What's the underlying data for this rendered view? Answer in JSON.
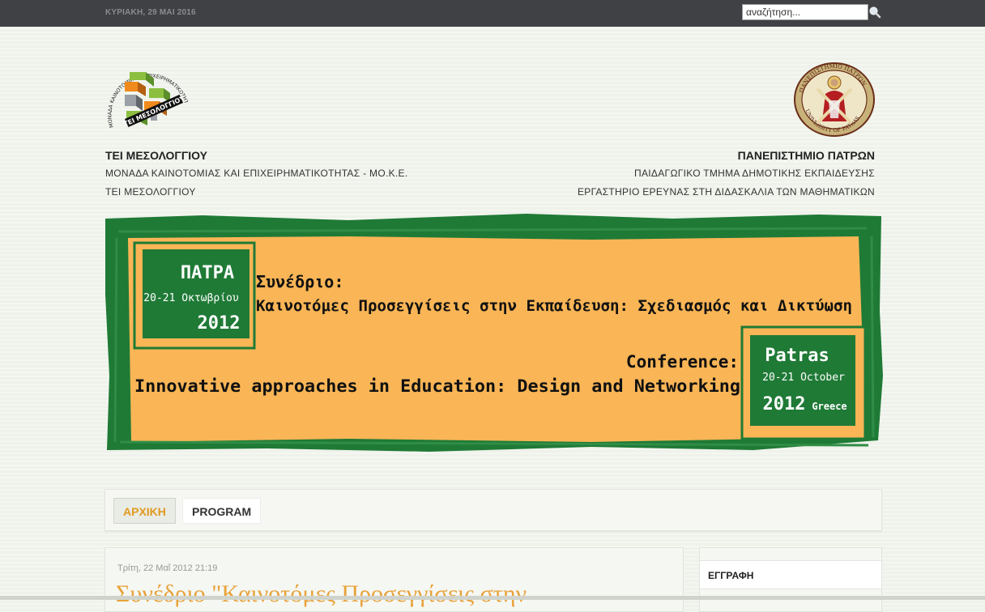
{
  "topbar": {
    "date": "ΚΥΡΙΑΚΗ, 29 ΜΑΙ 2016",
    "search_placeholder": "αναζήτηση...",
    "search_icon": "magnifier-icon"
  },
  "header": {
    "left": {
      "title": "ΤΕΙ ΜΕΣΟΛΟΓΓΙΟΥ",
      "line2": "ΜΟΝΑΔΑ ΚΑΙΝΟΤΟΜΙΑΣ ΚΑΙ ΕΠΙΧΕΙΡΗΜΑΤΙΚΟΤΗΤΑΣ - ΜΟ.Κ.Ε.",
      "line3": "ΤΕΙ ΜΕΣΟΛΟΓΓΙΟΥ",
      "logo_text_ring": "ΜΟΝΑΔΑ ΚΑΙΝΟΤΟΜΙΑΣ & ΕΠΙΧΕΙΡΗΜΑΤΙΚΟΤΗΤΑΣ",
      "logo_text_band": "ΤΕΙ ΜΕΣΟΛΟΓΓΙΟΥ"
    },
    "right": {
      "title": "ΠΑΝΕΠΙΣΤΗΜΙΟ ΠΑΤΡΩΝ",
      "line2": "ΠΑΙΔΑΓΩΓΙΚΟ ΤΜΗΜΑ ΔΗΜΟΤΙΚΗΣ ΕΚΠΑΙΔΕΥΣΗΣ",
      "line3": "ΕΡΓΑΣΤΗΡΙΟ ΕΡΕΥΝΑΣ ΣΤΗ ΔΙΔΑΣΚΑΛΙΑ ΤΩΝ ΜΑΘΗΜΑΤΙΚΩΝ",
      "seal_text_top": "ΠΑΝΕΠΙΣΤΗΜΙΟ ΠΑΤΡΩΝ",
      "seal_text_bottom": "UNIVERSITY OF PATRAS"
    }
  },
  "banner": {
    "gr_city": "ΠΑΤΡΑ",
    "gr_dates": "20-21 Οκτωβρίου",
    "gr_year": "2012",
    "gr_label": "Συνέδριο:",
    "gr_title": "Καινοτόμες Προσεγγίσεις στην Εκπαίδευση: Σχεδιασμός και Δικτύωση",
    "en_label": "Conference:",
    "en_title": "Innovative approaches in Education: Design and Networking",
    "en_city": "Patras",
    "en_dates": "20-21 October",
    "en_year": "2012",
    "en_country": "Greece",
    "colors": {
      "green": "#1f7a36",
      "orange": "#f9b556"
    }
  },
  "nav": {
    "home": "ΑΡΧΙΚΗ",
    "program": "PROGRAM"
  },
  "post": {
    "date": "Τρίτη, 22 Μαΐ 2012 21:19",
    "title": "Συνέδριο \"Καινοτόμες Προσεγγίσεις στην"
  },
  "sidebar": {
    "heading": "ΕΓΓΡΑΦΗ"
  },
  "colors": {
    "accent": "#e09a1f",
    "topbar": "#3f4144",
    "background": "#eef2ea"
  }
}
